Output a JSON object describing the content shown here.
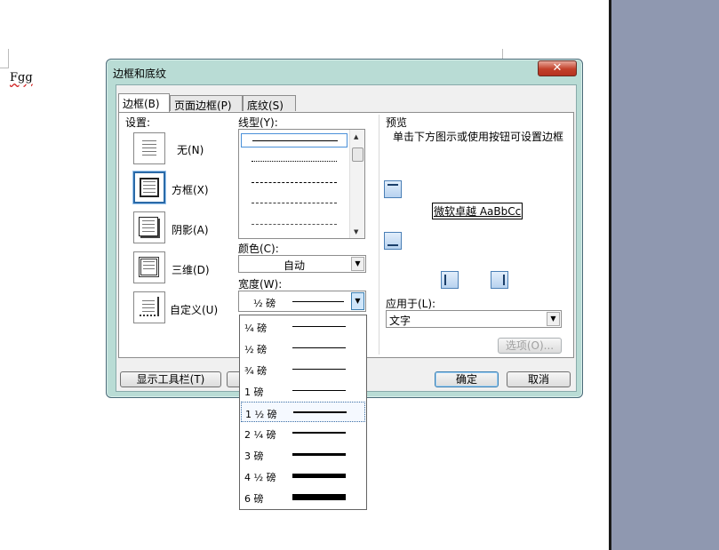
{
  "document": {
    "text": "Fgg"
  },
  "dialog": {
    "title": "边框和底纹",
    "close_symbol": "✕",
    "tabs": [
      {
        "label": "边框(B)",
        "active": true
      },
      {
        "label": "页面边框(P)",
        "active": false
      },
      {
        "label": "底纹(S)",
        "active": false
      }
    ],
    "settings": {
      "label": "设置:",
      "items": [
        {
          "label": "无(N)",
          "selected": false
        },
        {
          "label": "方框(X)",
          "selected": true
        },
        {
          "label": "阴影(A)",
          "selected": false
        },
        {
          "label": "三维(D)",
          "selected": false
        },
        {
          "label": "自定义(U)",
          "selected": false
        }
      ]
    },
    "line_style": {
      "label": "线型(Y):"
    },
    "color": {
      "label": "颜色(C):",
      "value": "自动"
    },
    "width": {
      "label": "宽度(W):",
      "value": "½ 磅"
    },
    "preview": {
      "label": "预览",
      "hint": "单击下方图示或使用按钮可设置边框",
      "sample_text": "微软卓越 AaBbCc"
    },
    "apply_to": {
      "label": "应用于(L):",
      "value": "文字"
    },
    "options_button": "选项(O)...",
    "toolbar_button": "显示工具栏(T)",
    "ok_button": "确定",
    "cancel_button": "取消"
  },
  "width_dropdown": {
    "items": [
      {
        "label": "¼ 磅",
        "weight": 0.25,
        "selected": false
      },
      {
        "label": "½ 磅",
        "weight": 0.5,
        "selected": false
      },
      {
        "label": "¾ 磅",
        "weight": 0.75,
        "selected": false
      },
      {
        "label": "1 磅",
        "weight": 1,
        "selected": false
      },
      {
        "label": "1 ½ 磅",
        "weight": 1.5,
        "selected": true
      },
      {
        "label": "2 ¼ 磅",
        "weight": 2.25,
        "selected": false
      },
      {
        "label": "3 磅",
        "weight": 3,
        "selected": false
      },
      {
        "label": "4 ½ 磅",
        "weight": 4.5,
        "selected": false
      },
      {
        "label": "6 磅",
        "weight": 6,
        "selected": false
      }
    ]
  }
}
